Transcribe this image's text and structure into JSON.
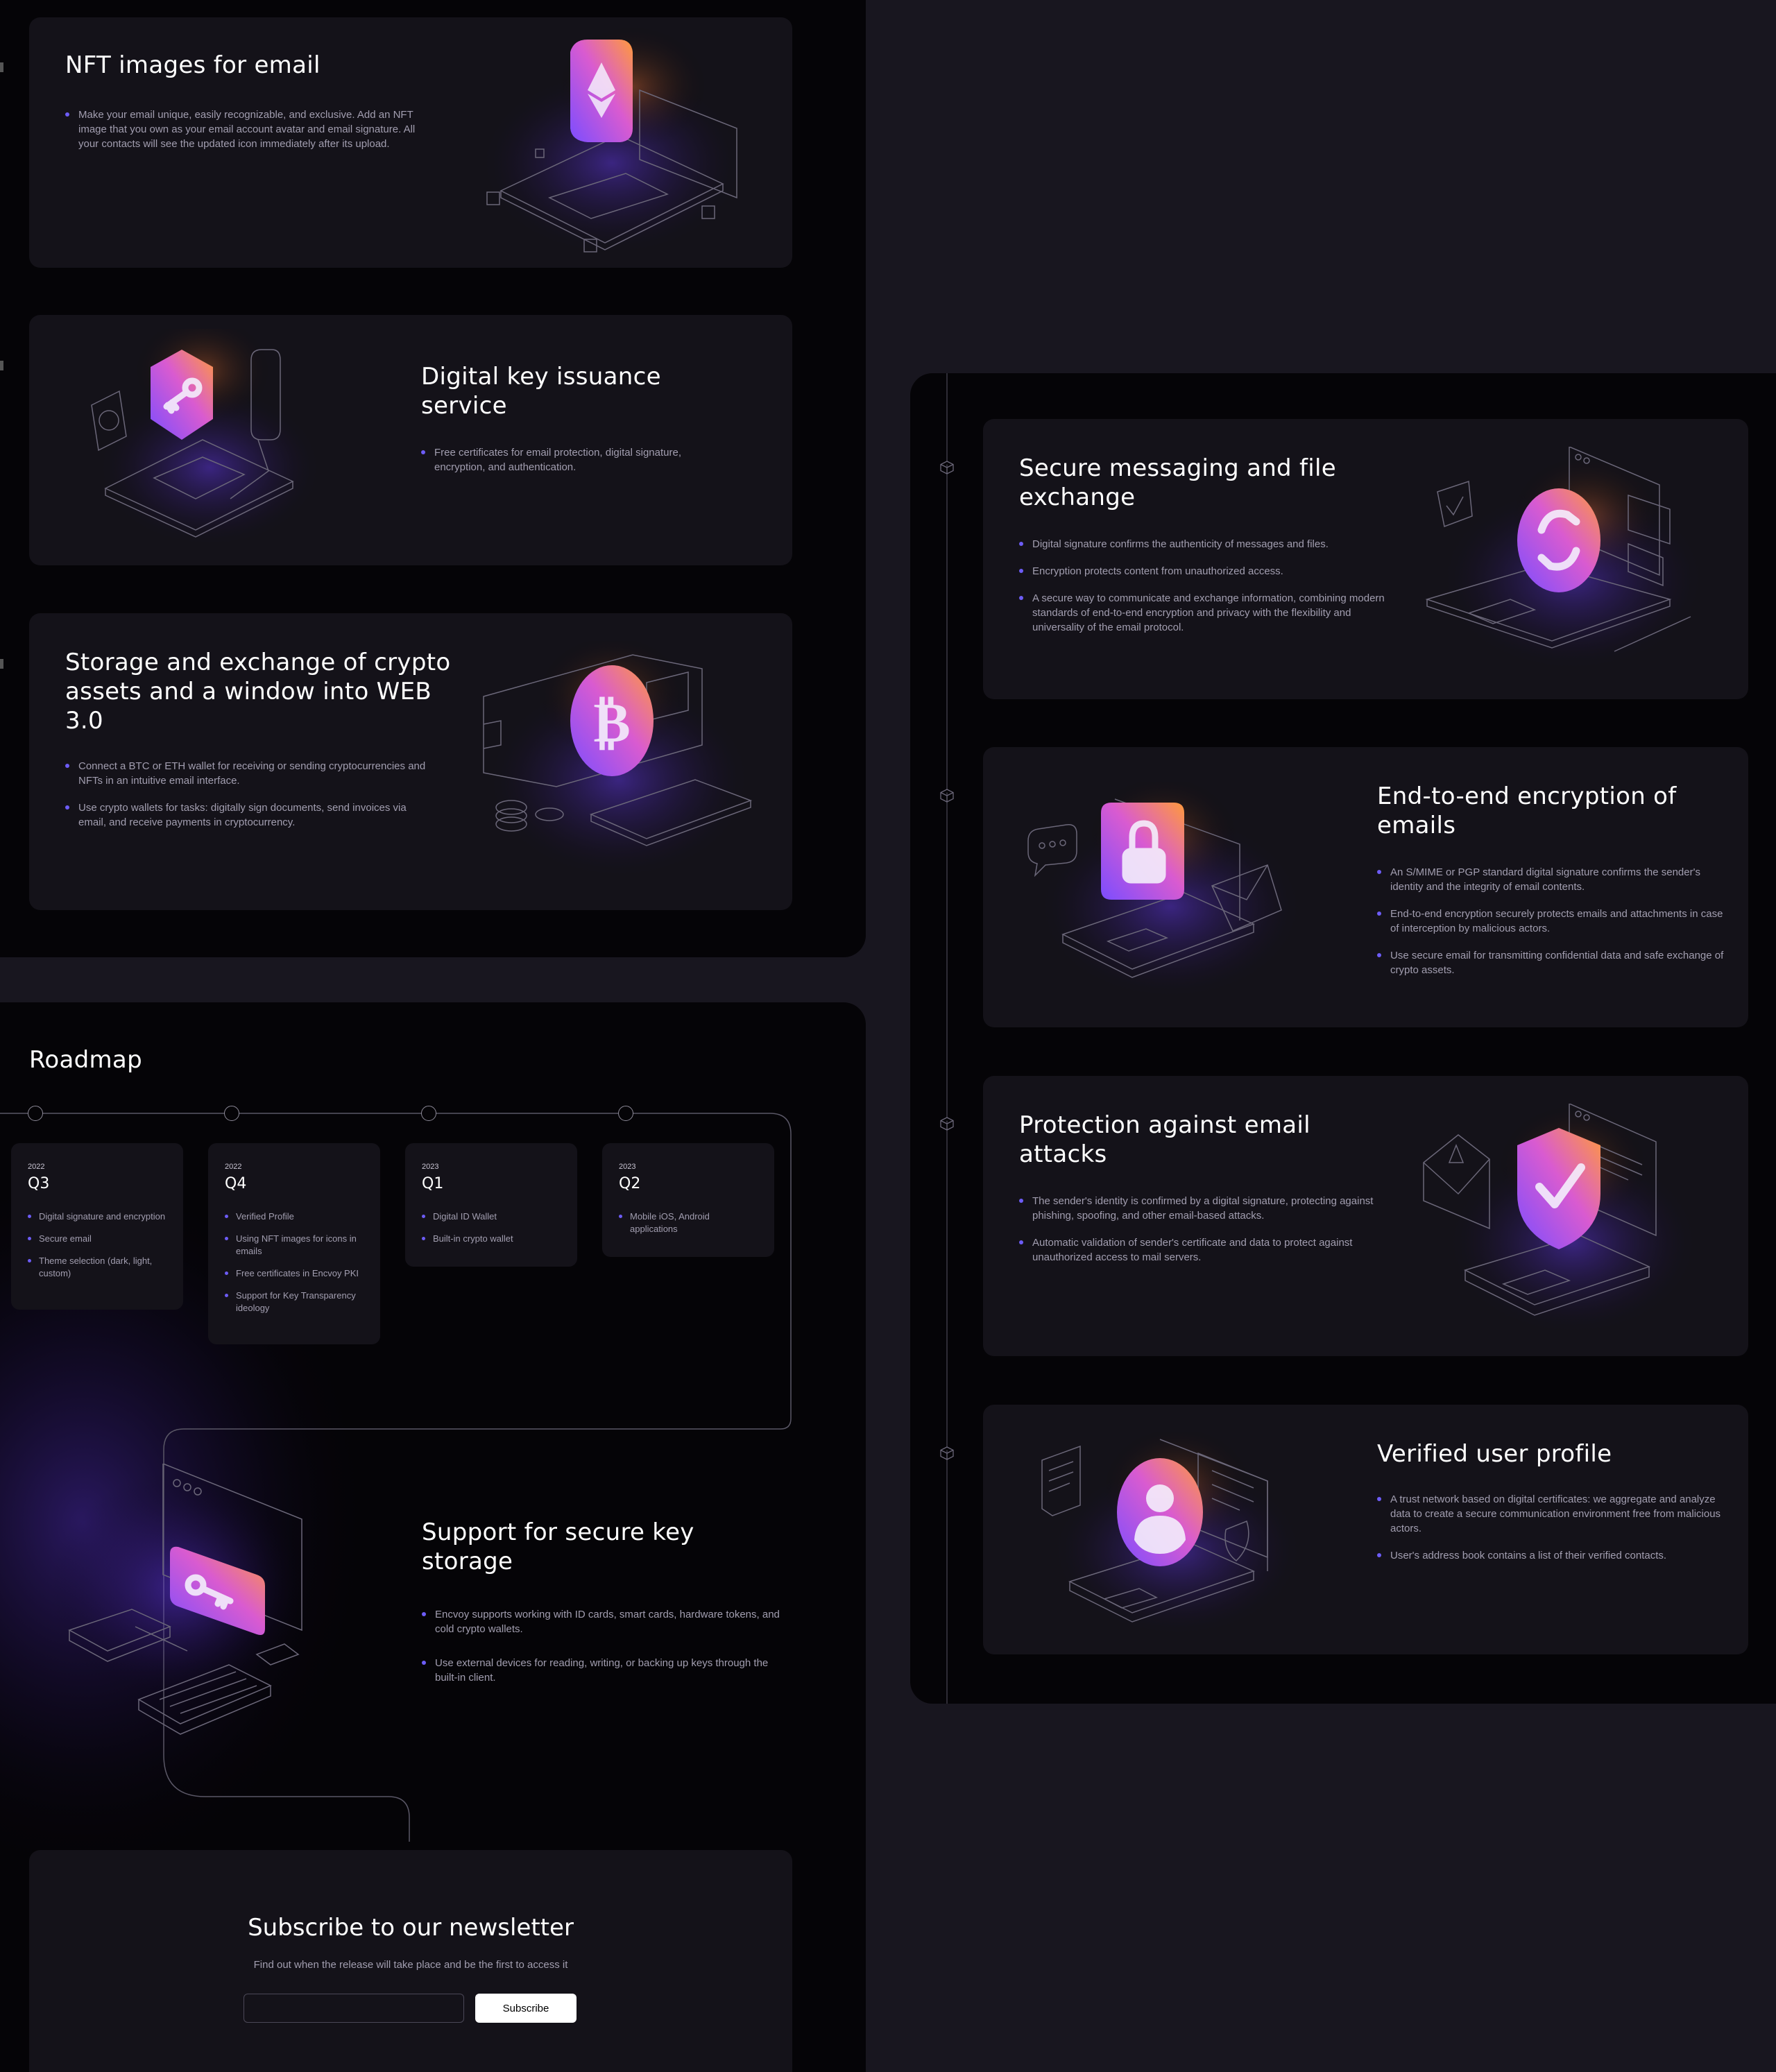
{
  "features_left": [
    {
      "title": "NFT images for email",
      "bullets": [
        "Make your email unique, easily recognizable, and exclusive. Add an NFT image that you own as your email account avatar and email signature. All your contacts will see the updated icon immediately after its upload."
      ]
    },
    {
      "title": "Digital key issuance service",
      "bullets": [
        "Free certificates for email protection, digital signature, encryption, and authentication."
      ]
    },
    {
      "title": "Storage and exchange of crypto assets and a window into WEB 3.0",
      "bullets": [
        "Connect a BTC or ETH wallet for receiving or sending cryptocurrencies and NFTs in an intuitive email interface.",
        "Use crypto wallets for tasks: digitally sign documents, send invoices via email, and receive payments in cryptocurrency."
      ]
    }
  ],
  "features_right": [
    {
      "title": "Secure messaging and file exchange",
      "bullets": [
        "Digital signature confirms the authenticity of messages and files.",
        "Encryption protects content from unauthorized access.",
        "A secure way to communicate and exchange information, combining modern standards of end-to-end encryption and privacy with the flexibility and universality of the email protocol."
      ]
    },
    {
      "title": "End-to-end encryption of emails",
      "bullets": [
        "An S/MIME or PGP standard digital signature confirms the sender's identity and the integrity of email contents.",
        "End-to-end encryption securely protects emails and attachments in case of interception by malicious actors.",
        "Use secure email for transmitting confidential data and safe exchange of crypto assets."
      ]
    },
    {
      "title": "Protection against email attacks",
      "bullets": [
        "The sender's identity is confirmed by a digital signature, protecting against phishing, spoofing, and other email-based attacks.",
        "Automatic validation of sender's certificate and data to protect against unauthorized access to mail servers."
      ]
    },
    {
      "title": "Verified user profile",
      "bullets": [
        "A trust network based on digital certificates: we aggregate and analyze data to create a secure communication environment free from malicious actors.",
        "User's address book contains a list of their verified contacts."
      ]
    }
  ],
  "roadmap": {
    "title": "Roadmap",
    "items": [
      {
        "year": "2022",
        "quarter": "Q3",
        "bullets": [
          "Digital signature and encryption",
          "Secure email",
          "Theme selection (dark, light, custom)"
        ]
      },
      {
        "year": "2022",
        "quarter": "Q4",
        "bullets": [
          "Verified Profile",
          "Using NFT images for icons in emails",
          "Free certificates in Encvoy PKI",
          "Support for Key Transparency ideology"
        ]
      },
      {
        "year": "2023",
        "quarter": "Q1",
        "bullets": [
          "Digital ID Wallet",
          "Built-in crypto wallet"
        ]
      },
      {
        "year": "2023",
        "quarter": "Q2",
        "bullets": [
          "Mobile iOS, Android applications"
        ]
      }
    ]
  },
  "key_storage": {
    "title": "Support for secure key storage",
    "bullets": [
      "Encvoy supports working with ID cards, smart cards, hardware tokens, and cold crypto wallets.",
      "Use external devices for reading, writing, or backing up keys through the built-in client."
    ]
  },
  "newsletter": {
    "title": "Subscribe to our newsletter",
    "subtitle": "Find out when the release will take place and be the first to access it",
    "input_placeholder": "",
    "button_label": "Subscribe"
  },
  "icons": {
    "nft": "ethereum-icon",
    "key": "key-icon",
    "crypto": "bitcoin-icon",
    "messaging": "sync-icon",
    "encryption": "lock-icon",
    "protection": "shield-check-icon",
    "profile": "user-icon",
    "storage": "key-card-icon"
  },
  "colors": {
    "background": "#18161f",
    "panel": "#050407",
    "card": "#141219",
    "accent": "#6d5cf6",
    "gradient_start": "#8a55ff",
    "gradient_end": "#ff8a3d"
  }
}
